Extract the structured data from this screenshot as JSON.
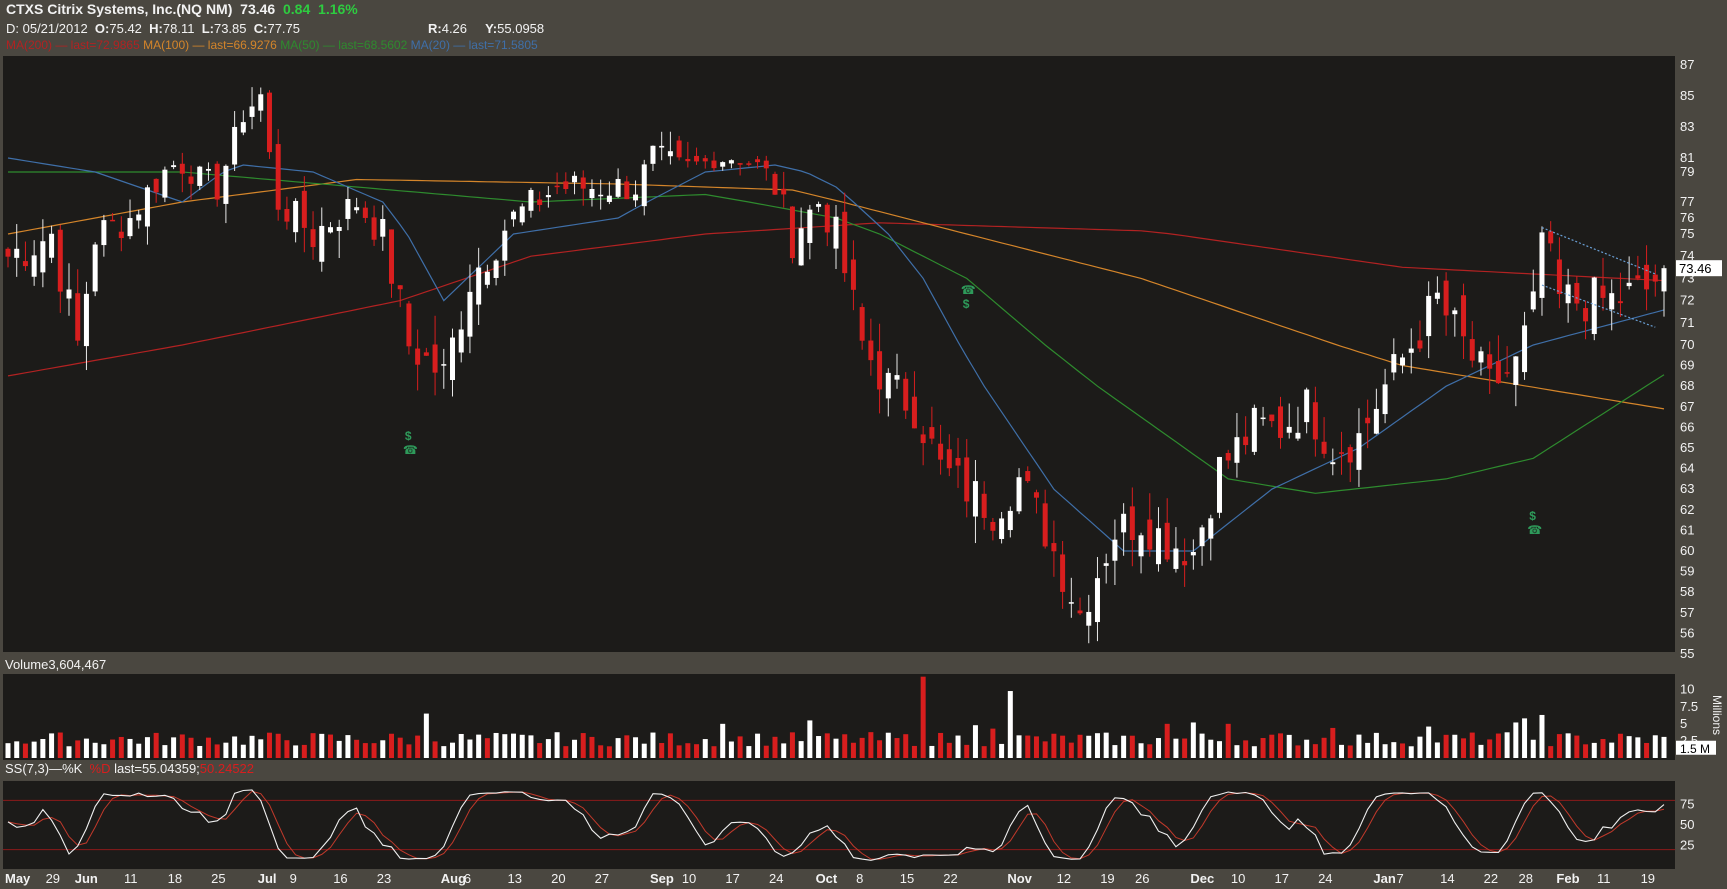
{
  "header": {
    "symbol": "CTXS Citrix Systems, Inc.(NQ NM)",
    "last": "73.46",
    "change": "0.84",
    "change_pct": "1.16%",
    "date_label": "D: 05/21/2012",
    "o_label": "O:",
    "o": "75.42",
    "h_label": "H:",
    "h": "78.11",
    "l_label": "L:",
    "l": "73.85",
    "c_label": "C:",
    "c": "77.75",
    "r_label": "R:",
    "r": "4.26",
    "y_label": "Y:",
    "y": "55.0958"
  },
  "legend": [
    {
      "text": "MA(200) — last=72.9865",
      "color": "#b22222"
    },
    {
      "text": "MA(100)",
      "color": "#d4852a"
    },
    {
      "text": "— last=66.9276",
      "color": "#d4852a"
    },
    {
      "text": "MA(50) — last=68.5602",
      "color": "#2e8b2e"
    },
    {
      "text": "MA(20) — last=71.5805",
      "color": "#3f6fa8"
    }
  ],
  "volume_panel": {
    "title": "Volume",
    "value": "3,604,467",
    "unit": "Millions",
    "last_label": "1.5 M"
  },
  "stoch_panel": {
    "title": "SS(7,3)",
    "k_label": "—%K",
    "d_label": "%D",
    "last_text": "last=55.04359;",
    "d_last": "50.24522"
  },
  "colors": {
    "up": "#ffffff",
    "down": "#d81e1e",
    "ma200": "#b22222",
    "ma100": "#d4852a",
    "ma50": "#2e8b2e",
    "ma20": "#3f6fa8",
    "accent": "#2ecc40",
    "marker": "#2e9a5a"
  },
  "chart_data": {
    "type": "candlestick",
    "price_axis": {
      "ylim": [
        55,
        87
      ],
      "ticks": [
        55,
        56,
        57,
        58,
        59,
        60,
        61,
        62,
        63,
        64,
        65,
        66,
        67,
        68,
        69,
        70,
        71,
        72,
        73,
        74,
        75,
        76,
        77,
        79,
        81,
        83,
        85,
        87
      ],
      "last_marker": "73.46"
    },
    "x_ticks": [
      {
        "label": "May",
        "i": 0,
        "month": true
      },
      {
        "label": "29",
        "i": 5
      },
      {
        "label": "Jun",
        "i": 8,
        "month": true
      },
      {
        "label": "11",
        "i": 14
      },
      {
        "label": "18",
        "i": 19
      },
      {
        "label": "25",
        "i": 24
      },
      {
        "label": "Jul",
        "i": 29,
        "month": true
      },
      {
        "label": "9",
        "i": 33
      },
      {
        "label": "16",
        "i": 38
      },
      {
        "label": "23",
        "i": 43
      },
      {
        "label": "Aug",
        "i": 50,
        "month": true
      },
      {
        "label": "6",
        "i": 53
      },
      {
        "label": "13",
        "i": 58
      },
      {
        "label": "20",
        "i": 63
      },
      {
        "label": "27",
        "i": 68
      },
      {
        "label": "Sep",
        "i": 74,
        "month": true
      },
      {
        "label": "10",
        "i": 78
      },
      {
        "label": "17",
        "i": 83
      },
      {
        "label": "24",
        "i": 88
      },
      {
        "label": "Oct",
        "i": 93,
        "month": true
      },
      {
        "label": "8",
        "i": 98
      },
      {
        "label": "15",
        "i": 103
      },
      {
        "label": "22",
        "i": 108
      },
      {
        "label": "Nov",
        "i": 115,
        "month": true
      },
      {
        "label": "12",
        "i": 121
      },
      {
        "label": "19",
        "i": 126
      },
      {
        "label": "26",
        "i": 130
      },
      {
        "label": "Dec",
        "i": 136,
        "month": true
      },
      {
        "label": "10",
        "i": 141
      },
      {
        "label": "17",
        "i": 146
      },
      {
        "label": "24",
        "i": 151
      },
      {
        "label": "Jan",
        "i": 157,
        "month": true
      },
      {
        "label": "7",
        "i": 160
      },
      {
        "label": "14",
        "i": 165
      },
      {
        "label": "22",
        "i": 170
      },
      {
        "label": "28",
        "i": 174
      },
      {
        "label": "Feb",
        "i": 178,
        "month": true
      },
      {
        "label": "11",
        "i": 183
      },
      {
        "label": "19",
        "i": 188
      }
    ],
    "close_anchors": [
      [
        0,
        74
      ],
      [
        5,
        75
      ],
      [
        8,
        70
      ],
      [
        10,
        75
      ],
      [
        14,
        76
      ],
      [
        19,
        80
      ],
      [
        24,
        78
      ],
      [
        27,
        84
      ],
      [
        29,
        85
      ],
      [
        31,
        77
      ],
      [
        35,
        75
      ],
      [
        40,
        77
      ],
      [
        43,
        75
      ],
      [
        46,
        70
      ],
      [
        50,
        68.5
      ],
      [
        53,
        73
      ],
      [
        58,
        76
      ],
      [
        63,
        78
      ],
      [
        68,
        78
      ],
      [
        72,
        78
      ],
      [
        74,
        81
      ],
      [
        78,
        80
      ],
      [
        83,
        81
      ],
      [
        86,
        80
      ],
      [
        88,
        78
      ],
      [
        90,
        75
      ],
      [
        93,
        77
      ],
      [
        95,
        75
      ],
      [
        98,
        70
      ],
      [
        101,
        68
      ],
      [
        104,
        67
      ],
      [
        107,
        64
      ],
      [
        110,
        63
      ],
      [
        113,
        62
      ],
      [
        116,
        63.5
      ],
      [
        119,
        61
      ],
      [
        121,
        59
      ],
      [
        123,
        57
      ],
      [
        125,
        59
      ],
      [
        127,
        61
      ],
      [
        130,
        61.5
      ],
      [
        133,
        60.5
      ],
      [
        136,
        60
      ],
      [
        139,
        64
      ],
      [
        143,
        66
      ],
      [
        146,
        66
      ],
      [
        149,
        67
      ],
      [
        152,
        65
      ],
      [
        155,
        65.5
      ],
      [
        158,
        68
      ],
      [
        161,
        70
      ],
      [
        164,
        72
      ],
      [
        167,
        70
      ],
      [
        170,
        68
      ],
      [
        173,
        69
      ],
      [
        175,
        71.5
      ],
      [
        176,
        75
      ],
      [
        178,
        72
      ],
      [
        181,
        72
      ],
      [
        184,
        72
      ],
      [
        188,
        72.5
      ],
      [
        190,
        73.46
      ]
    ],
    "volume": {
      "ylim": [
        0,
        12
      ],
      "ticks": [
        2.5,
        5,
        7.5,
        10
      ],
      "spikes": [
        [
          105,
          11.9
        ],
        [
          115,
          9.8
        ],
        [
          111,
          4.8
        ],
        [
          113,
          4.3
        ],
        [
          176,
          6.3
        ],
        [
          48,
          6.5
        ],
        [
          82,
          5.0
        ],
        [
          92,
          5.5
        ],
        [
          136,
          5.2
        ],
        [
          152,
          4.4
        ],
        [
          173,
          5.2
        ],
        [
          174,
          5.8
        ],
        [
          133,
          5.0
        ],
        [
          140,
          5.0
        ],
        [
          163,
          4.6
        ]
      ]
    },
    "stochastic": {
      "ylim": [
        0,
        100
      ],
      "ticks": [
        25,
        50,
        75
      ],
      "overbought": 80,
      "oversold": 20
    },
    "ma_paths": {
      "ma200": [
        [
          0,
          68.5
        ],
        [
          20,
          70
        ],
        [
          45,
          72
        ],
        [
          60,
          74
        ],
        [
          80,
          75
        ],
        [
          100,
          75.7
        ],
        [
          130,
          75.2
        ],
        [
          160,
          73.5
        ],
        [
          190,
          72.9
        ]
      ],
      "ma100": [
        [
          0,
          75
        ],
        [
          20,
          77
        ],
        [
          40,
          78.5
        ],
        [
          70,
          78.2
        ],
        [
          90,
          77.8
        ],
        [
          110,
          75
        ],
        [
          130,
          73
        ],
        [
          160,
          69
        ],
        [
          190,
          66.9
        ]
      ],
      "ma50": [
        [
          0,
          79
        ],
        [
          20,
          79
        ],
        [
          40,
          78
        ],
        [
          60,
          77
        ],
        [
          80,
          77.5
        ],
        [
          95,
          76
        ],
        [
          110,
          73
        ],
        [
          125,
          68
        ],
        [
          140,
          63.5
        ],
        [
          150,
          62.8
        ],
        [
          165,
          63.5
        ],
        [
          175,
          64.5
        ],
        [
          190,
          68.56
        ]
      ],
      "ma20": [
        [
          0,
          81
        ],
        [
          10,
          79
        ],
        [
          20,
          77
        ],
        [
          27,
          80
        ],
        [
          35,
          79
        ],
        [
          43,
          77
        ],
        [
          50,
          72
        ],
        [
          58,
          75
        ],
        [
          70,
          76
        ],
        [
          80,
          79
        ],
        [
          88,
          80
        ],
        [
          95,
          78
        ],
        [
          105,
          73
        ],
        [
          112,
          68
        ],
        [
          120,
          63
        ],
        [
          128,
          60
        ],
        [
          136,
          60
        ],
        [
          145,
          63
        ],
        [
          155,
          65
        ],
        [
          165,
          68
        ],
        [
          175,
          70
        ],
        [
          190,
          71.58
        ]
      ]
    },
    "annotations": [
      {
        "type": "dividend+conference",
        "i": 46,
        "price": 65.4
      },
      {
        "type": "conference+dividend",
        "i": 110,
        "price": 72.3
      },
      {
        "type": "dividend+conference",
        "i": 175,
        "price": 61.5
      }
    ]
  }
}
